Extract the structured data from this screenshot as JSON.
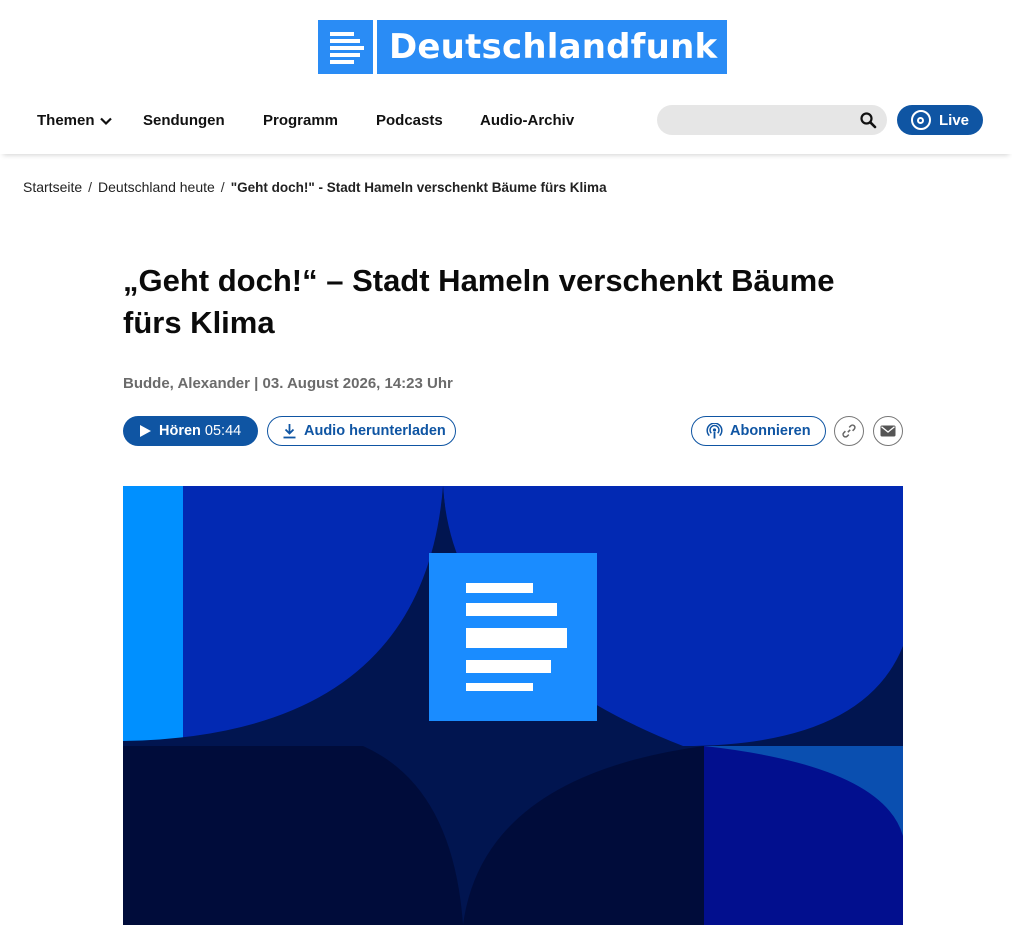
{
  "header": {
    "logo_text": "Deutschlandfunk"
  },
  "nav": {
    "items": [
      {
        "label": "Themen"
      },
      {
        "label": "Sendungen"
      },
      {
        "label": "Programm"
      },
      {
        "label": "Podcasts"
      },
      {
        "label": "Audio-Archiv"
      }
    ],
    "search_placeholder": "",
    "live_label": "Live"
  },
  "breadcrumb": {
    "items": [
      "Startseite",
      "Deutschland heute"
    ],
    "separator": "/",
    "current": "\"Geht doch!\" - Stadt Hameln verschenkt Bäume fürs Klima"
  },
  "article": {
    "headline": "„Geht doch!“ – Stadt Hameln verschenkt Bäume fürs Klima",
    "byline": "Budde, Alexander | 03. August 2026, 14:23 Uhr",
    "play_label": "Hören",
    "duration": "05:44",
    "download_label": "Audio herunterladen",
    "subscribe_label": "Abonnieren"
  },
  "colors": {
    "brand_blue": "#2a8cf5",
    "button_blue": "#0f55a3",
    "hero_royal": "#0229b3",
    "hero_navy": "#011550",
    "hero_dark": "#000c3a"
  },
  "icons": [
    "themen-chevron-down-icon",
    "search-icon",
    "live-radio-icon",
    "play-icon",
    "download-icon",
    "podcast-icon",
    "link-icon",
    "mail-icon"
  ]
}
